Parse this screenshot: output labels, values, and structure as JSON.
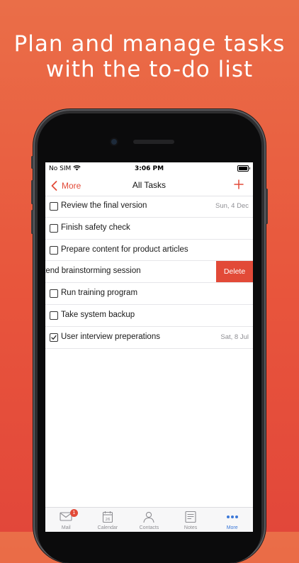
{
  "headline": {
    "line1": "Plan and manage tasks",
    "line2": "with the to-do list"
  },
  "status_bar": {
    "carrier": "No SIM",
    "time": "3:06 PM"
  },
  "nav": {
    "back_label": "More",
    "title": "All Tasks"
  },
  "tasks": [
    {
      "title": "Review the final version",
      "date": "Sun, 4 Dec",
      "checked": false
    },
    {
      "title": "Finish safety check",
      "date": "",
      "checked": false
    },
    {
      "title": "Prepare content for product articles",
      "date": "",
      "checked": false
    },
    {
      "title": "ttend brainstorming session",
      "date": "",
      "checked": false,
      "action": "Delete"
    },
    {
      "title": "Run training program",
      "date": "",
      "checked": false
    },
    {
      "title": "Take system backup",
      "date": "",
      "checked": false
    },
    {
      "title": "User interview preperations",
      "date": "Sat, 8 Jul",
      "checked": true
    }
  ],
  "tabbar": {
    "tabs": [
      {
        "label": "Mail",
        "icon": "mail-icon",
        "badge": "1"
      },
      {
        "label": "Calendar",
        "icon": "calendar-icon",
        "calendar_day": "26"
      },
      {
        "label": "Contacts",
        "icon": "contacts-icon"
      },
      {
        "label": "Notes",
        "icon": "notes-icon"
      },
      {
        "label": "More",
        "icon": "more-icon",
        "active": true
      }
    ]
  },
  "colors": {
    "accent": "#e24a38",
    "active_tab": "#3b78d8",
    "background_top": "#ea6e48",
    "background_bottom": "#e2473a"
  }
}
